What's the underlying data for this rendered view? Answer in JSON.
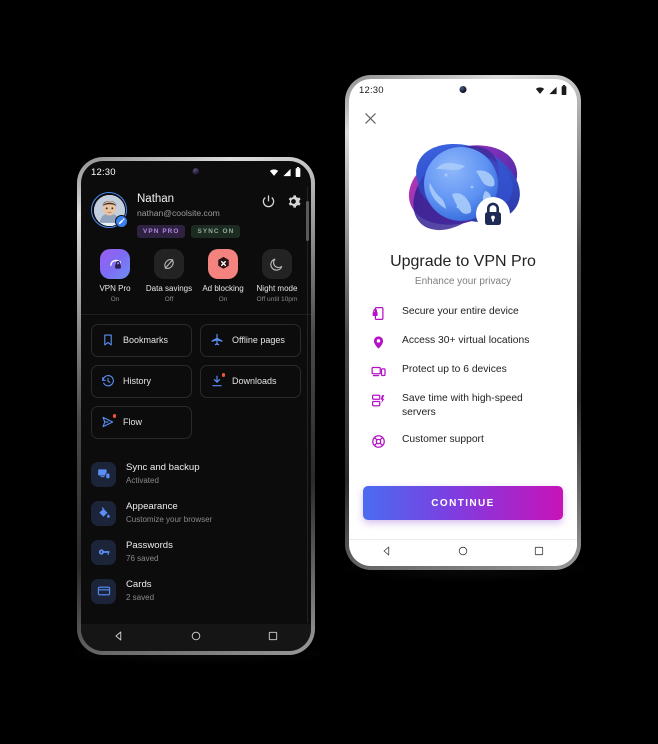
{
  "left_phone": {
    "statusbar": {
      "clock": "12:30",
      "wifi_icon": "wifi-icon",
      "signal_icon": "signal-icon",
      "battery_icon": "battery-icon"
    },
    "profile": {
      "name": "Nathan",
      "email": "nathan@coolsite.com",
      "avatar_name": "avatar",
      "edit_badge_icon": "edit-pencil-icon",
      "badges": [
        {
          "label": "VPN PRO",
          "name": "badge-vpn-pro"
        },
        {
          "label": "SYNC ON",
          "name": "badge-sync-on"
        }
      ],
      "power_icon": "power-icon",
      "settings_icon": "gear-icon"
    },
    "quick_actions": [
      {
        "label": "VPN Pro",
        "status": "On",
        "icon": "vpn-shield-lock-icon",
        "tile": "gradient"
      },
      {
        "label": "Data savings",
        "status": "Off",
        "icon": "leaf-icon",
        "tile": "grey"
      },
      {
        "label": "Ad blocking",
        "status": "On",
        "icon": "ad-block-x-icon",
        "tile": "coral"
      },
      {
        "label": "Night mode",
        "status": "Off until 10pm",
        "icon": "moon-icon",
        "tile": "grey"
      }
    ],
    "cards": [
      {
        "label": "Bookmarks",
        "icon": "bookmark-icon",
        "badge": false
      },
      {
        "label": "Offline pages",
        "icon": "airplane-icon",
        "badge": false
      },
      {
        "label": "History",
        "icon": "history-clock-icon",
        "badge": false
      },
      {
        "label": "Downloads",
        "icon": "download-icon",
        "badge": true
      },
      {
        "label": "Flow",
        "icon": "flow-send-icon",
        "badge": true
      }
    ],
    "list_items": [
      {
        "title": "Sync and backup",
        "subtitle": "Activated",
        "icon": "sync-devices-icon"
      },
      {
        "title": "Appearance",
        "subtitle": "Customize your browser",
        "icon": "paint-bucket-icon"
      },
      {
        "title": "Passwords",
        "subtitle": "76 saved",
        "icon": "key-icon"
      },
      {
        "title": "Cards",
        "subtitle": "2 saved",
        "icon": "credit-card-icon"
      }
    ],
    "navbar": {
      "back_icon": "back-triangle-icon",
      "home_icon": "home-circle-icon",
      "recents_icon": "recents-square-icon"
    }
  },
  "right_phone": {
    "statusbar": {
      "clock": "12:30",
      "wifi_icon": "wifi-icon",
      "signal_icon": "signal-icon",
      "battery_icon": "battery-icon"
    },
    "close_icon": "close-icon",
    "hero_icon": "globe-lock-illustration",
    "title": "Upgrade to VPN Pro",
    "subtitle": "Enhance your privacy",
    "features": [
      {
        "text": "Secure your entire device",
        "icon": "device-lock-icon"
      },
      {
        "text": "Access 30+ virtual locations",
        "icon": "location-pin-icon"
      },
      {
        "text": "Protect up to 6 devices",
        "icon": "devices-icon"
      },
      {
        "text": "Save time with high-speed servers",
        "icon": "speed-server-icon"
      },
      {
        "text": "Customer support",
        "icon": "lifebuoy-icon"
      }
    ],
    "cta_label": "CONTINUE",
    "navbar": {
      "back_icon": "back-triangle-icon",
      "home_icon": "home-circle-icon",
      "recents_icon": "recents-square-icon"
    }
  },
  "colors": {
    "accent_purple": "#b512c6",
    "accent_blue": "#5b8ef5",
    "cta_gradient_start": "#4a6cf0",
    "cta_gradient_end": "#c713b8",
    "coral": "#f4837f",
    "background": "#000000"
  }
}
